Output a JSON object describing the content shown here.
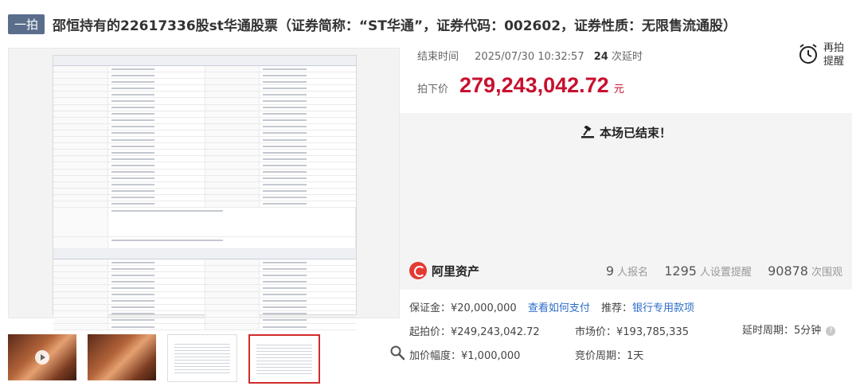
{
  "header": {
    "badge": "一拍",
    "title": "邵恒持有的22617336股st华通股票（证券简称：“ST华通”，证券代码：002602，证券性质：无限售流通股）"
  },
  "auction": {
    "end_time_label": "结束时间",
    "end_time": "2025/07/30 10:32:57",
    "delay_count": "24",
    "delay_label": "次延时",
    "remind_label": "再拍提醒",
    "final_price_label": "拍下价",
    "final_price": "279,243,042.72",
    "price_unit": "元",
    "ended_text": "本场已结束！"
  },
  "platform": {
    "name": "阿里资产"
  },
  "stats": {
    "signups": "9",
    "signups_label": "人报名",
    "reminders": "1295",
    "reminders_label": "人设置提醒",
    "views": "90878",
    "views_label": "次围观"
  },
  "details": {
    "deposit": "保证金：¥20,000,000",
    "how_to_pay": "查看如何支付",
    "recommend_label": "推荐：",
    "recommend_link": "银行专用款项",
    "start_price": "起拍价：¥249,243,042.72",
    "market_price": "市场价：¥193,785,335",
    "delay_period": "延时周期：5分钟",
    "increment": "加价幅度：¥1,000,000",
    "bid_period": "竞价周期：1天"
  },
  "colors": {
    "price_red": "#c8102e",
    "link_blue": "#2b6dc8",
    "badge_bg": "#5a6e8c",
    "selected_border": "#d12b2b"
  },
  "icons": [
    "alarm-clock-icon",
    "gavel-icon",
    "zoom-icon",
    "help-icon",
    "play-icon"
  ]
}
